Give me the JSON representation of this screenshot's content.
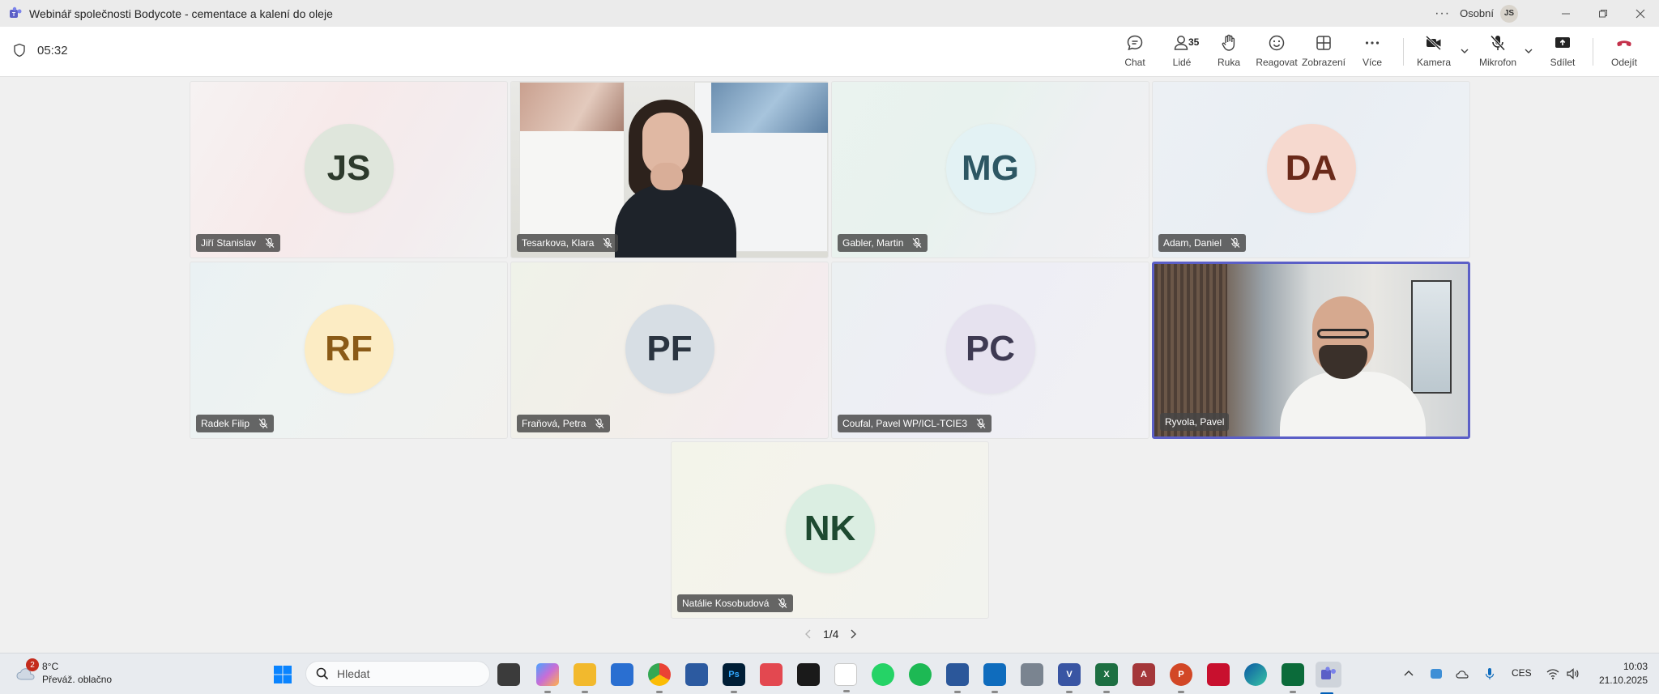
{
  "window": {
    "title": "Webinář společnosti Bodycote - cementace a kalení do oleje",
    "more": "···",
    "profile_label": "Osobní",
    "profile_initials": "JS"
  },
  "meeting": {
    "elapsed": "05:32",
    "people_count": "35"
  },
  "toolbar": {
    "chat": "Chat",
    "people": "Lidé",
    "raise_hand": "Ruka",
    "react": "Reagovat",
    "view": "Zobrazení",
    "more": "Více",
    "camera": "Kamera",
    "mic": "Mikrofon",
    "share": "Sdílet",
    "leave": "Odejít",
    "leave_color": "#c4314b"
  },
  "participants": [
    {
      "name": "Jiří Stanislav",
      "initials": "JS",
      "avatar_bg": "#dfe6dc",
      "avatar_fg": "#2d3a2c",
      "muted": true
    },
    {
      "name": "Tesarkova, Klara",
      "initials": "",
      "video": true,
      "muted": true
    },
    {
      "name": "Gabler, Martin",
      "initials": "MG",
      "avatar_bg": "#e3f2f4",
      "avatar_fg": "#2d5763",
      "muted": true
    },
    {
      "name": "Adam, Daniel",
      "initials": "DA",
      "avatar_bg": "#f6d9cf",
      "avatar_fg": "#6a2a1a",
      "muted": true
    },
    {
      "name": "Radek Filip",
      "initials": "RF",
      "avatar_bg": "#fcecc4",
      "avatar_fg": "#8a5a17",
      "muted": true
    },
    {
      "name": "Fraňová, Petra",
      "initials": "PF",
      "avatar_bg": "#d7dee4",
      "avatar_fg": "#2a3440",
      "muted": true
    },
    {
      "name": "Coufal, Pavel WP/ICL-TCIE3",
      "initials": "PC",
      "avatar_bg": "#e6e2ef",
      "avatar_fg": "#3e3a52",
      "muted": true
    },
    {
      "name": "Ryvola, Pavel",
      "initials": "",
      "video": true,
      "active_speaker": true,
      "muted": false
    },
    {
      "name": "Natálie Kosobudová",
      "initials": "NK",
      "avatar_bg": "#dbeee2",
      "avatar_fg": "#1d4a30",
      "muted": true
    }
  ],
  "pager": {
    "text": "1/4"
  },
  "taskbar": {
    "weather_badge": "2",
    "temperature": "8°C",
    "weather_desc": "Převáž. oblačno",
    "search_placeholder": "Hledat",
    "language": "CES",
    "time": "10:03",
    "date": "21.10.2025",
    "apps": [
      "task-view",
      "copilot",
      "file-explorer",
      "microsoft-store",
      "chrome",
      "save-app",
      "photoshop",
      "creative-cloud",
      "acrobat",
      "snipping-tool",
      "whatsapp",
      "spotify",
      "word-online",
      "outlook",
      "calculator",
      "visio",
      "excel",
      "access",
      "powerpoint",
      "pdf-app",
      "edge",
      "camtasia",
      "teams"
    ]
  }
}
